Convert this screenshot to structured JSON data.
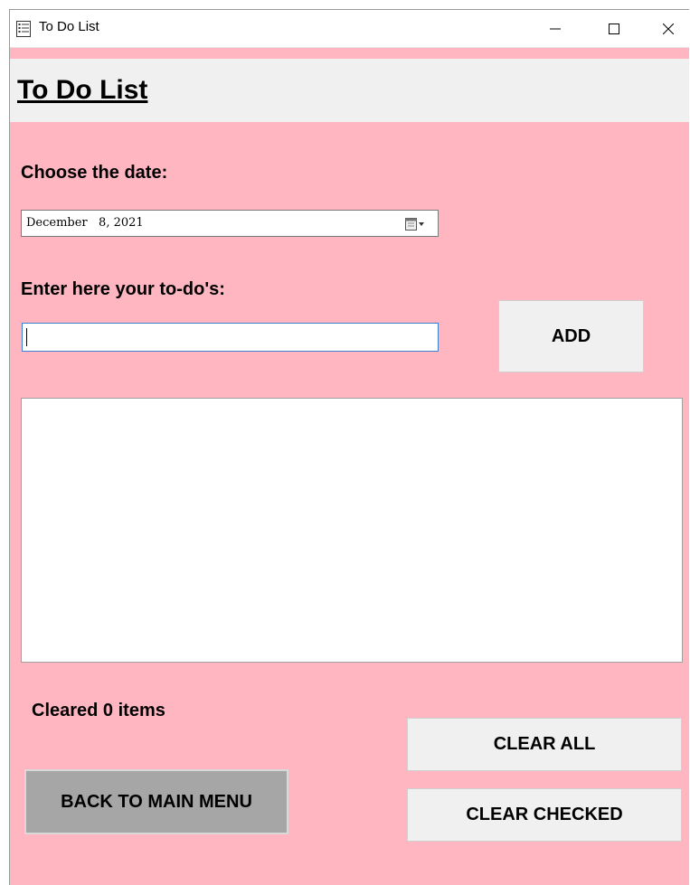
{
  "window": {
    "title": "To Do List",
    "background_color": "#ffb6c1",
    "controls": [
      "minimize-icon",
      "maximize-icon",
      "close-icon"
    ]
  },
  "page": {
    "title": "To Do List"
  },
  "date_section": {
    "label": "Choose the date:",
    "value": "December   8, 2021",
    "icon": "calendar-dropdown-icon"
  },
  "todo_section": {
    "label": "Enter here your to-do's:",
    "input_value": "",
    "add_label": "ADD"
  },
  "list": {
    "items": []
  },
  "status": {
    "cleared_text": "Cleared 0 items"
  },
  "buttons": {
    "clear_all": "CLEAR ALL",
    "clear_checked": "CLEAR CHECKED",
    "back": "BACK TO MAIN  MENU"
  }
}
